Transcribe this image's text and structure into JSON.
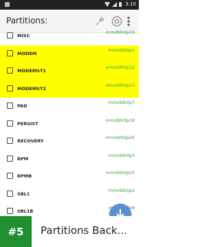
{
  "status_bar": {
    "time": "3:10"
  },
  "app_bar": {
    "title": "Partitions:"
  },
  "partitions": [
    {
      "name": "MISC",
      "device": "mmcblk0p15",
      "highlighted": false
    },
    {
      "name": "MODEM",
      "device": "mmcblk0p1",
      "highlighted": true
    },
    {
      "name": "MODEMST1",
      "device": "mmcblk0p12",
      "highlighted": true
    },
    {
      "name": "MODEMST2",
      "device": "mmcblk0p13",
      "highlighted": true
    },
    {
      "name": "PAD",
      "device": "mmcblk0p7",
      "highlighted": false
    },
    {
      "name": "PERSIST",
      "device": "mmcblk0p16",
      "highlighted": false
    },
    {
      "name": "RECOVERY",
      "device": "mmcblk0p20",
      "highlighted": false
    },
    {
      "name": "RPM",
      "device": "mmcblk0p3",
      "highlighted": false
    },
    {
      "name": "RPMB",
      "device": "mmcblk0p10",
      "highlighted": false
    },
    {
      "name": "SBL1",
      "device": "mmcblk0p2",
      "highlighted": false
    },
    {
      "name": "SBL1B",
      "device": "mmcblk0p8",
      "highlighted": false
    }
  ],
  "banner": {
    "rank": "#5",
    "title": "Partitions Back..."
  },
  "colors": {
    "highlight": "#ffff00",
    "device_text": "#2ea043",
    "rank_badge": "#1f8f2f",
    "fab": "#5d8fcf"
  }
}
